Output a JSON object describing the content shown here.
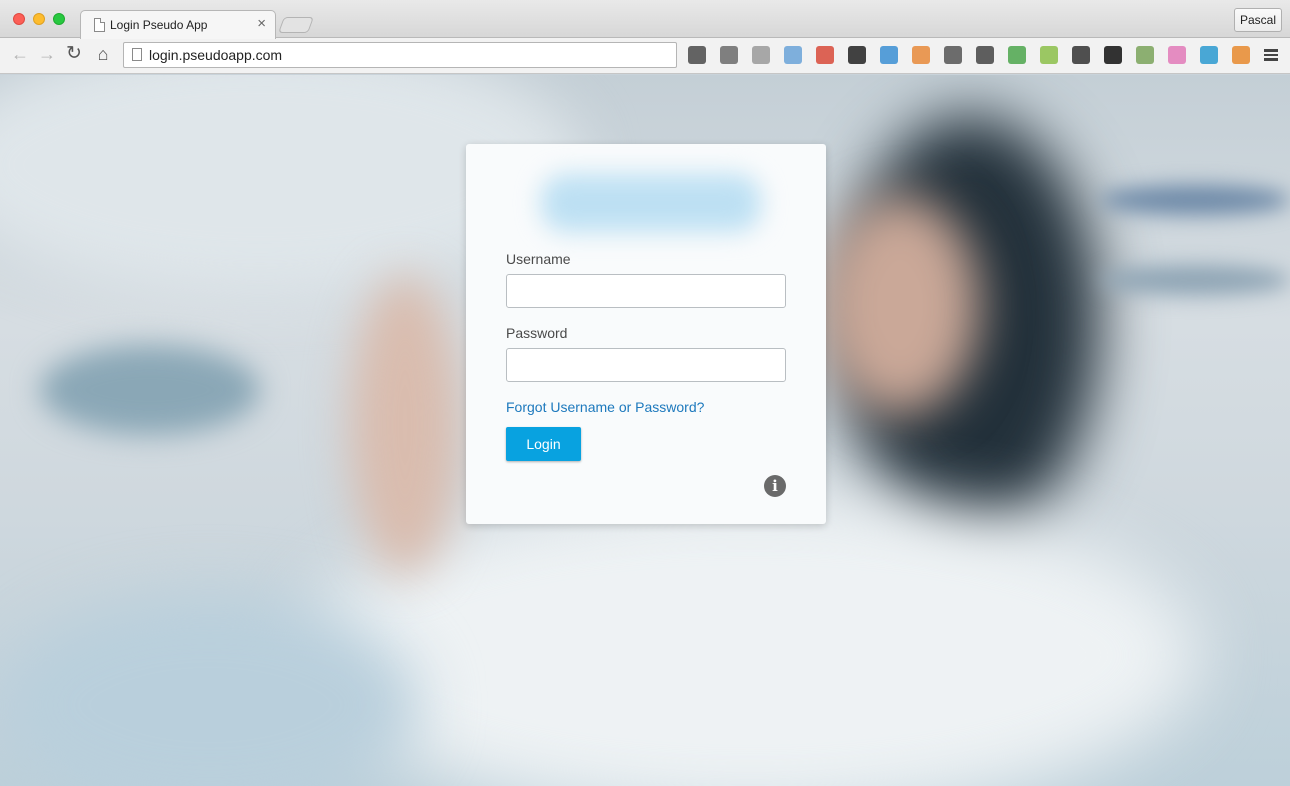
{
  "browser": {
    "tab_title": "Login Pseudo App",
    "tab_close": "×",
    "profile_name": "Pascal",
    "url": "login.pseudoapp.com",
    "nav": {
      "back_icon": "←",
      "forward_icon": "→",
      "reload_icon": "↻",
      "home_icon": "⌂"
    },
    "extensions": [
      {
        "name": "eyedropper-icon",
        "color": "#4a4a4a"
      },
      {
        "name": "ghostery-icon",
        "color": "#6b6b6b"
      },
      {
        "name": "download-icon",
        "color": "#9a9a9a"
      },
      {
        "name": "document-icon",
        "color": "#6aa3d8"
      },
      {
        "name": "red-book-icon",
        "color": "#d84a3a"
      },
      {
        "name": "font-query-icon",
        "color": "#222222"
      },
      {
        "name": "colorful-mascot-icon",
        "color": "#3b8fd3"
      },
      {
        "name": "orange-tool-icon",
        "color": "#e88a3a"
      },
      {
        "name": "clock-icon",
        "color": "#555555"
      },
      {
        "name": "cast-icon",
        "color": "#444444"
      },
      {
        "name": "green-doc-icon",
        "color": "#4ca64c"
      },
      {
        "name": "android-icon",
        "color": "#8cc04a"
      },
      {
        "name": "ruler-icon",
        "color": "#333333"
      },
      {
        "name": "glasses-icon",
        "color": "#111111"
      },
      {
        "name": "js-icon",
        "color": "#7aa35a"
      },
      {
        "name": "k-icon",
        "color": "#e27ab8"
      },
      {
        "name": "network-icon",
        "color": "#2c9ad0"
      },
      {
        "name": "orange-stand-icon",
        "color": "#e8892e"
      },
      {
        "name": "menu-icon",
        "color": "#444444"
      }
    ]
  },
  "login": {
    "username_label": "Username",
    "username_value": "",
    "password_label": "Password",
    "password_value": "",
    "forgot_link": "Forgot Username or Password?",
    "login_button": "Login",
    "info_icon": "i"
  },
  "colors": {
    "accent": "#08a2e0",
    "link": "#1d79bd"
  }
}
